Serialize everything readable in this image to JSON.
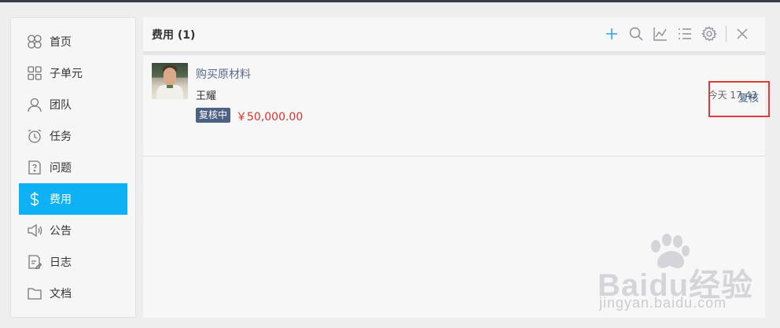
{
  "sidebar": {
    "items": [
      {
        "label": "首页",
        "icon": "clover-icon"
      },
      {
        "label": "子单元",
        "icon": "grid-icon"
      },
      {
        "label": "团队",
        "icon": "user-icon"
      },
      {
        "label": "任务",
        "icon": "alarm-clock-icon"
      },
      {
        "label": "问题",
        "icon": "question-doc-icon"
      },
      {
        "label": "费用",
        "icon": "dollar-icon",
        "active": true
      },
      {
        "label": "公告",
        "icon": "speaker-icon"
      },
      {
        "label": "日志",
        "icon": "log-edit-icon"
      },
      {
        "label": "文档",
        "icon": "folder-icon"
      }
    ]
  },
  "main": {
    "title": "费用 (1)",
    "toolbar": [
      "add-icon",
      "search-icon",
      "chart-icon",
      "list-icon",
      "settings-icon",
      "close-icon"
    ]
  },
  "record": {
    "title": "购买原材料",
    "person": "王耀",
    "status": "复核中",
    "amount": "￥50,000.00",
    "time": "今天 17:43",
    "action": "复核"
  },
  "watermark": {
    "brand": "Baidu经验",
    "url": "jingyan.baidu.com"
  },
  "colors": {
    "accent": "#0fb1f5",
    "status_badge": "#4d6185",
    "amount": "#e0322b",
    "highlight_box": "#e03a3a"
  }
}
